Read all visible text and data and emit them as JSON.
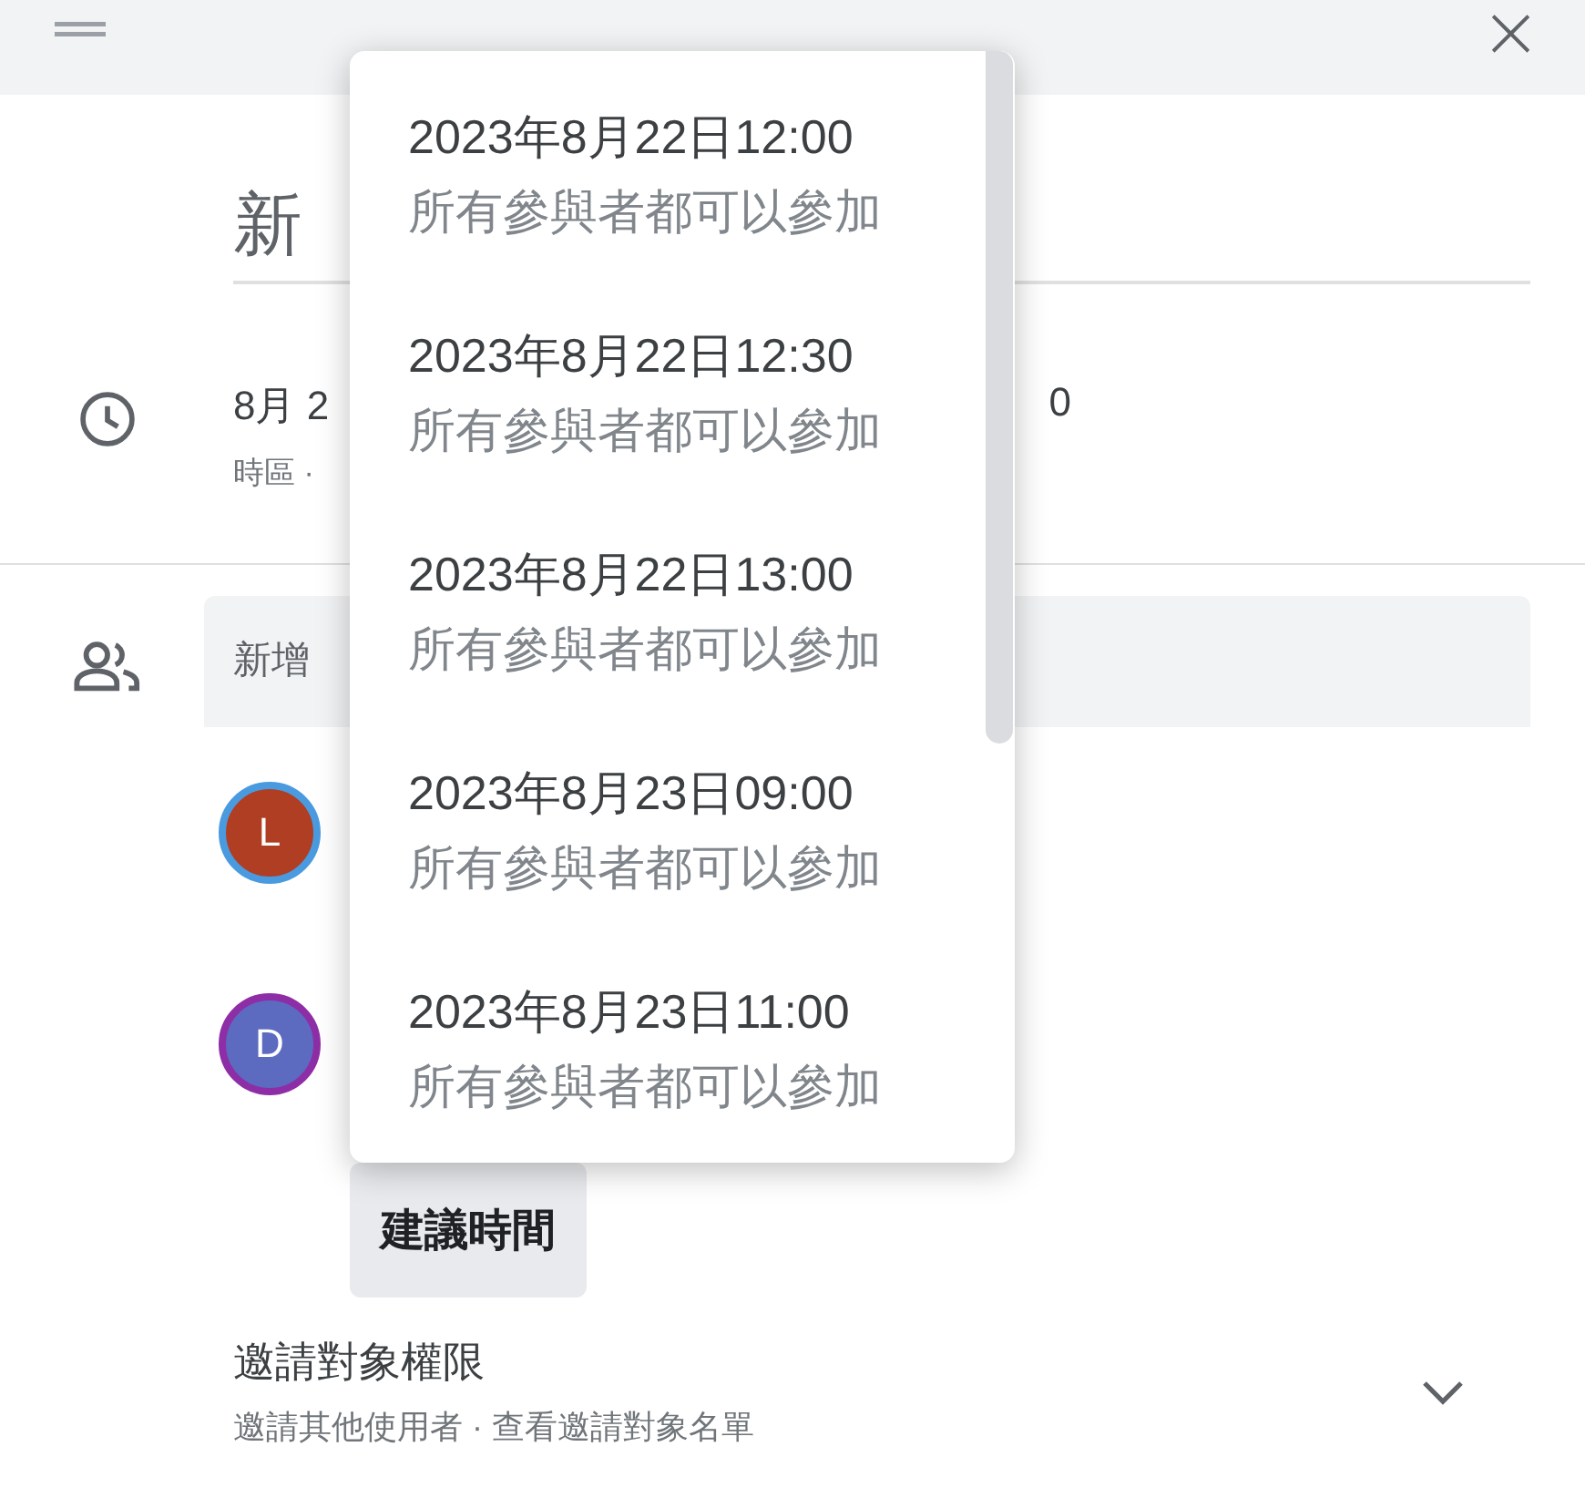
{
  "header": {
    "close": "×"
  },
  "title": {
    "value": "新"
  },
  "time": {
    "start": "8月 2",
    "end": "0",
    "timezone": "時區 ·"
  },
  "guests": {
    "placeholder": "新增"
  },
  "avatars": [
    {
      "initial": "L",
      "color": "#b03e22",
      "ring": {
        "color": "#4a9ae0"
      }
    },
    {
      "initial": "D",
      "color": "#5c6bc0",
      "ring": {
        "color": "#8e2ea6"
      }
    }
  ],
  "suggest_button": "建議時間",
  "permissions": {
    "title": "邀請對象權限",
    "subtitle": "邀請其他使用者 · 查看邀請對象名單"
  },
  "menu": {
    "items": [
      {
        "time": "2023年8月22日12:00",
        "note": "所有參與者都可以參加"
      },
      {
        "time": "2023年8月22日12:30",
        "note": "所有參與者都可以參加"
      },
      {
        "time": "2023年8月22日13:00",
        "note": "所有參與者都可以參加"
      },
      {
        "time": "2023年8月23日09:00",
        "note": "所有參與者都可以參加"
      },
      {
        "time": "2023年8月23日11:00",
        "note": "所有參與者都可以參加"
      }
    ]
  }
}
